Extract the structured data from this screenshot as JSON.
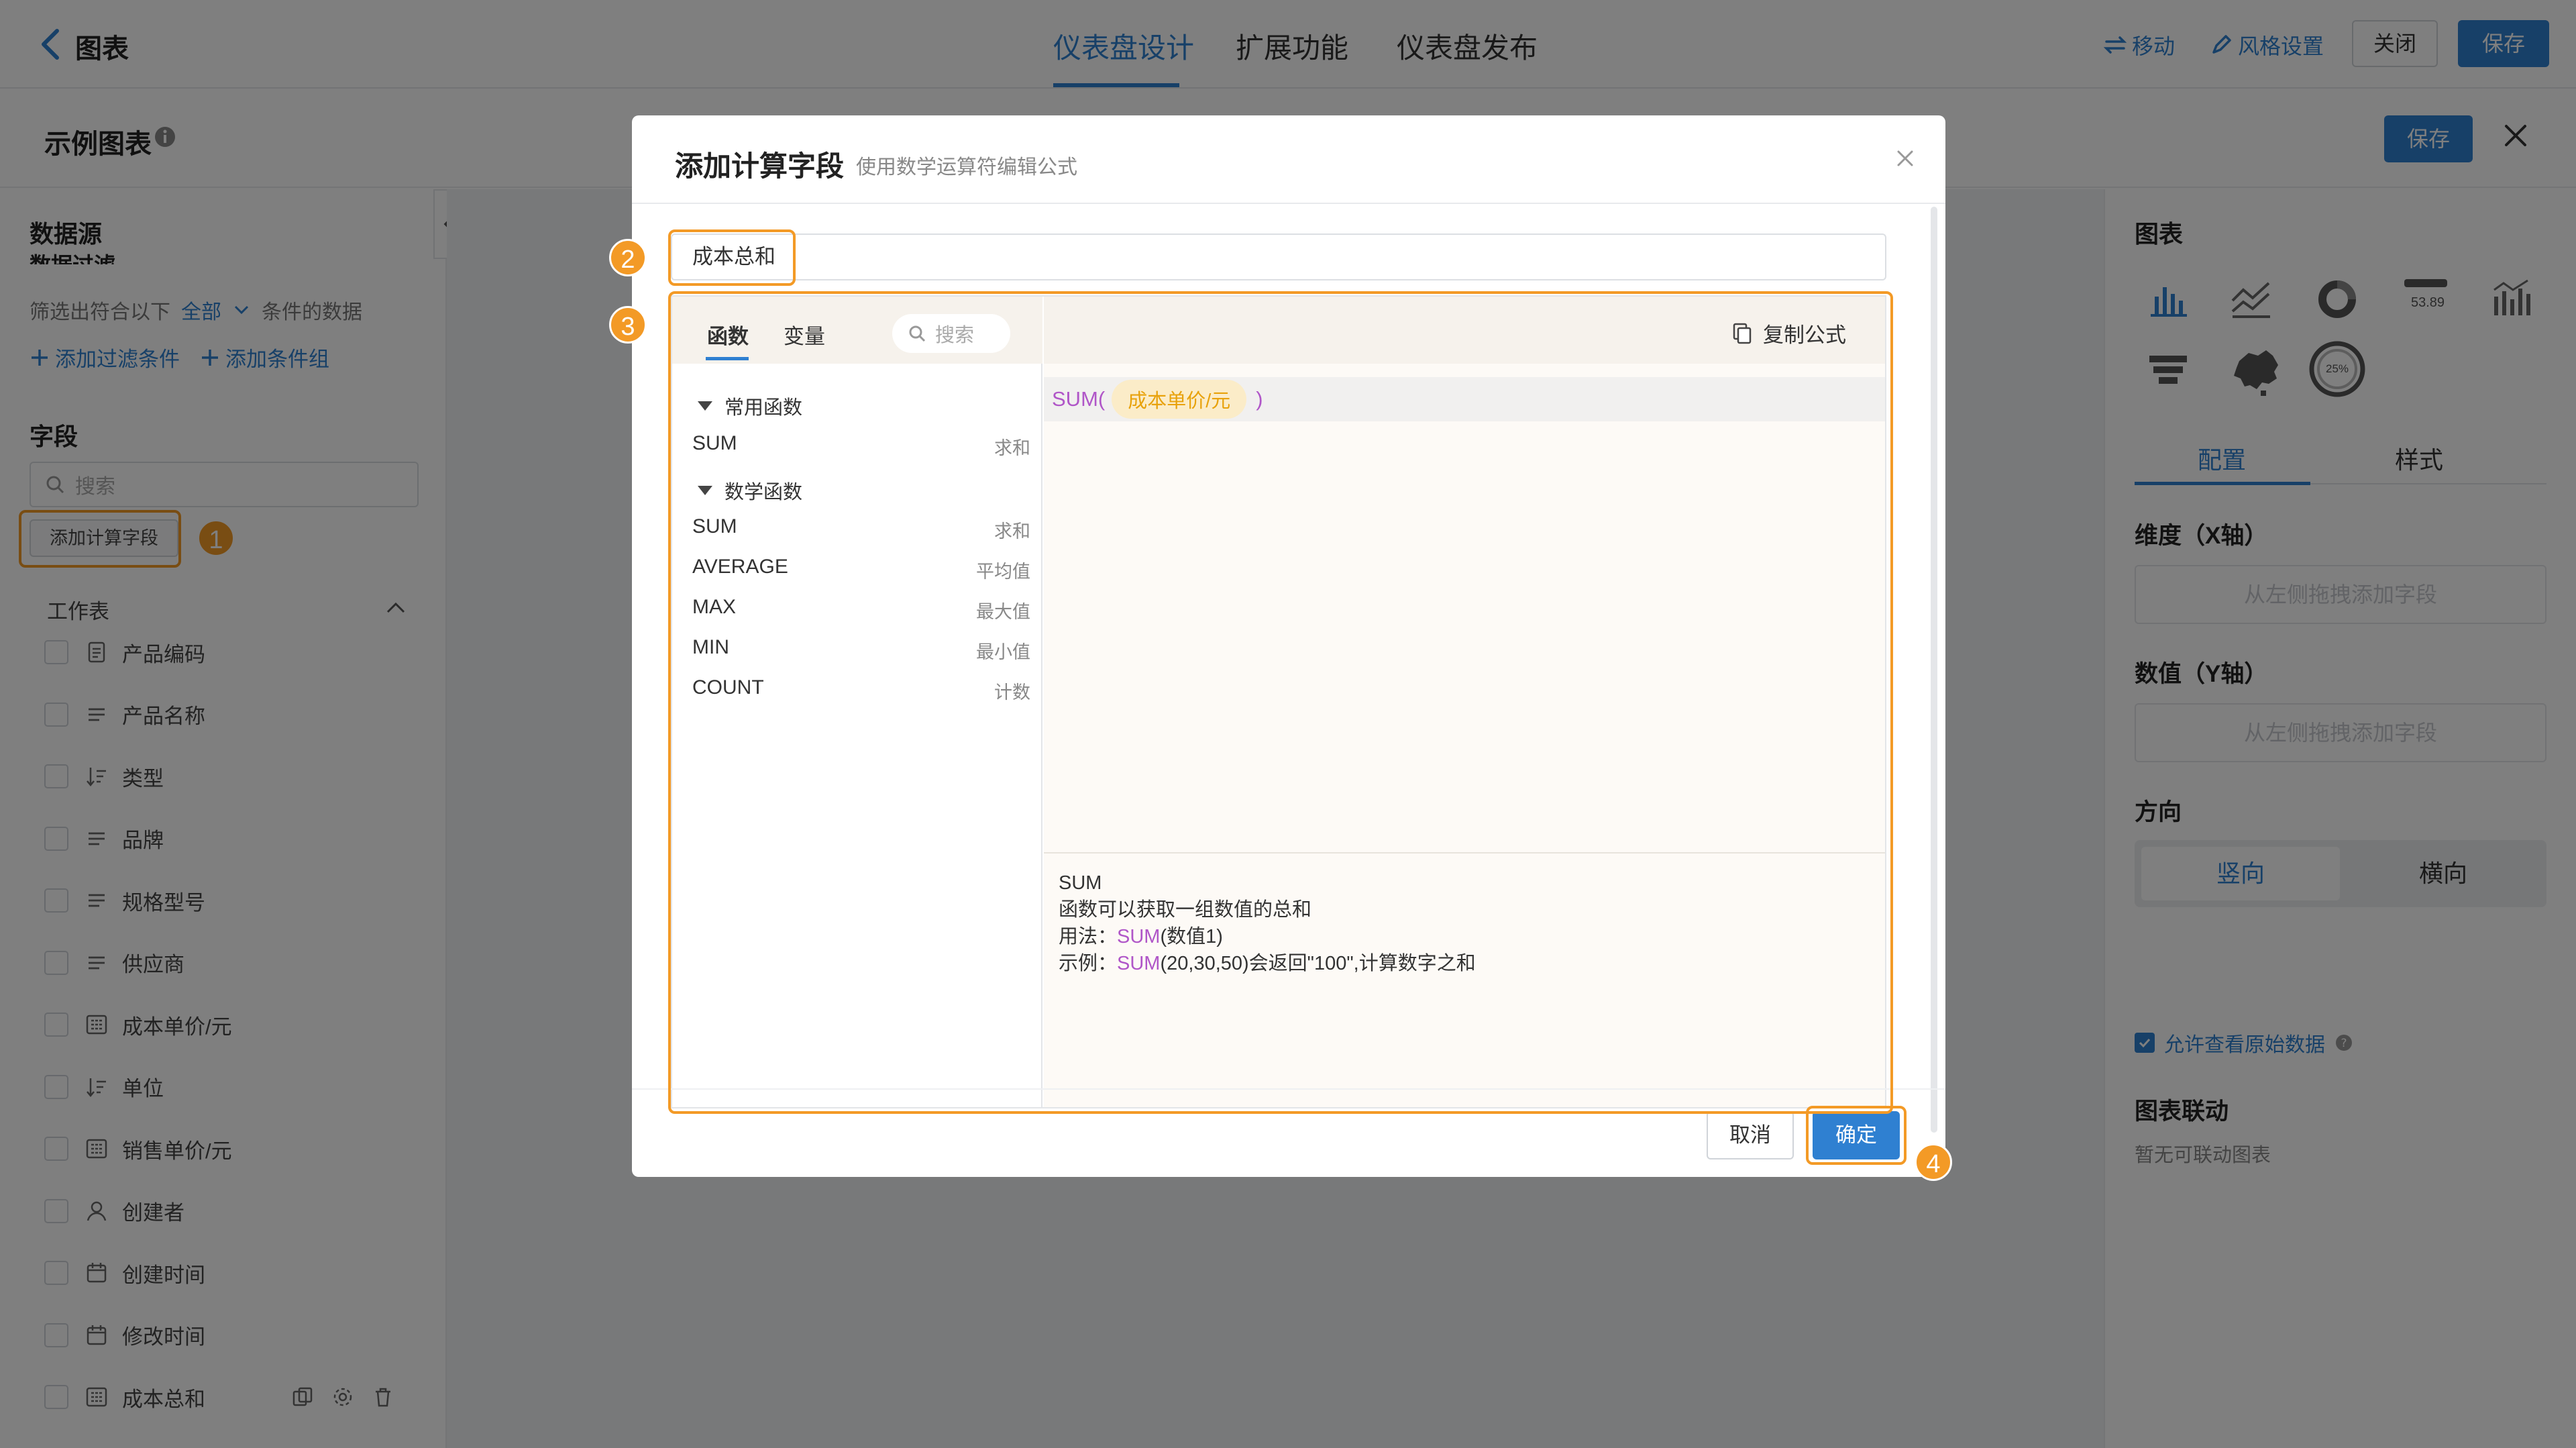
{
  "topbar": {
    "title": "图表",
    "tabs": [
      {
        "label": "仪表盘设计",
        "active": true
      },
      {
        "label": "扩展功能",
        "active": false
      },
      {
        "label": "仪表盘发布",
        "active": false
      }
    ],
    "actions": {
      "move": "移动",
      "style": "风格设置",
      "close": "关闭",
      "save": "保存"
    }
  },
  "editor": {
    "title": "示例图表",
    "save": "保存"
  },
  "left": {
    "datasource_title": "数据源",
    "datafilter_title": "数据过滤",
    "filter_prefix": "筛选出符合以下",
    "filter_mode": "全部",
    "filter_suffix": "条件的数据",
    "add_filter": "添加过滤条件",
    "add_group": "添加条件组",
    "fields_title": "字段",
    "search_placeholder": "搜索",
    "add_calc_button": "添加计算字段",
    "worksheet": "工作表",
    "fields": [
      {
        "label": "产品编码",
        "icon": "doc-icon"
      },
      {
        "label": "产品名称",
        "icon": "text-icon"
      },
      {
        "label": "类型",
        "icon": "sort-icon"
      },
      {
        "label": "品牌",
        "icon": "text-icon"
      },
      {
        "label": "规格型号",
        "icon": "text-icon"
      },
      {
        "label": "供应商",
        "icon": "text-icon"
      },
      {
        "label": "成本单价/元",
        "icon": "number-icon"
      },
      {
        "label": "单位",
        "icon": "sort-icon"
      },
      {
        "label": "销售单价/元",
        "icon": "number-icon"
      },
      {
        "label": "创建者",
        "icon": "user-icon"
      },
      {
        "label": "创建时间",
        "icon": "calendar-icon"
      },
      {
        "label": "修改时间",
        "icon": "calendar-icon"
      },
      {
        "label": "成本总和",
        "icon": "number-icon"
      }
    ]
  },
  "right": {
    "chart_title": "图表",
    "tabs": {
      "config": "配置",
      "style": "样式"
    },
    "dimension_title": "维度（X轴）",
    "dimension_placeholder": "从左侧拖拽添加字段",
    "value_title": "数值（Y轴）",
    "value_placeholder": "从左侧拖拽添加字段",
    "direction_title": "方向",
    "direction_vertical": "竖向",
    "direction_horizontal": "横向",
    "allow_raw": "允许查看原始数据",
    "linkage_title": "图表联动",
    "linkage_empty": "暂无可联动图表",
    "metric_value": "53.89",
    "ring_value": "25%"
  },
  "modal": {
    "title": "添加计算字段",
    "subtitle": "使用数学运算符编辑公式",
    "field_name": "成本总和",
    "tabs": {
      "functions": "函数",
      "variables": "变量",
      "search": "搜索"
    },
    "copy_formula": "复制公式",
    "groups": [
      {
        "title": "常用函数",
        "items": [
          {
            "name": "SUM",
            "desc": "求和"
          }
        ]
      },
      {
        "title": "数学函数",
        "items": [
          {
            "name": "SUM",
            "desc": "求和"
          },
          {
            "name": "AVERAGE",
            "desc": "平均值"
          },
          {
            "name": "MAX",
            "desc": "最大值"
          },
          {
            "name": "MIN",
            "desc": "最小值"
          },
          {
            "name": "COUNT",
            "desc": "计数"
          }
        ]
      }
    ],
    "formula": {
      "func": "SUM(",
      "chip": "成本单价/元",
      "close": ")"
    },
    "help": {
      "name": "SUM",
      "desc": "函数可以获取一组数值的总和",
      "usage_label": "用法：",
      "usage_func": "SUM",
      "usage_args": "(数值1)",
      "example_label": "示例：",
      "example_func": "SUM",
      "example_rest": "(20,30,50)会返回\"100\",计算数字之和"
    },
    "cancel": "取消",
    "confirm": "确定"
  },
  "annotations": [
    "1",
    "2",
    "3",
    "4"
  ],
  "colors": {
    "accent": "#2f80d1",
    "highlight": "#f39a26",
    "formula_func": "#b056c8",
    "chip_text": "#e8a20b"
  }
}
